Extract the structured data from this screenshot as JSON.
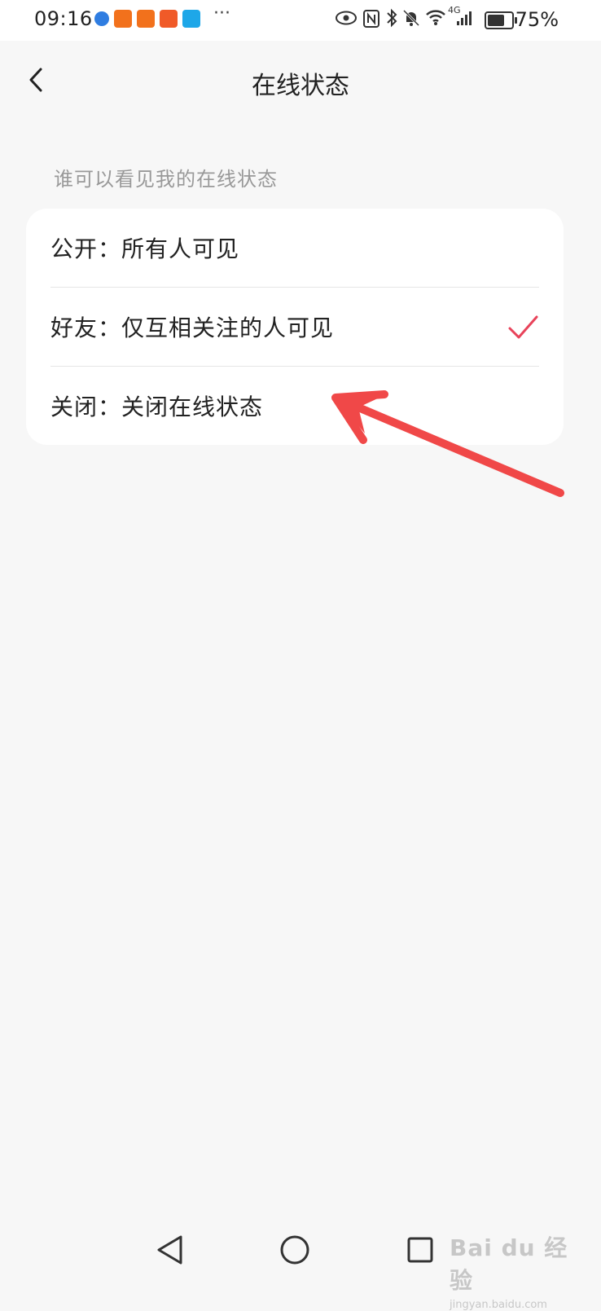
{
  "status_bar": {
    "time": "09:16",
    "battery": "75%",
    "more": "···",
    "network": "4G",
    "icons": [
      "eye-icon",
      "nfc-icon",
      "bluetooth-icon",
      "bell-off-icon",
      "wifi-icon",
      "signal-icon",
      "battery-icon"
    ],
    "app_icons": [
      {
        "name": "browser-app-icon",
        "color": "#2f7de1"
      },
      {
        "name": "app-icon-1",
        "color": "#f2711c"
      },
      {
        "name": "app-icon-2",
        "color": "#f2711c"
      },
      {
        "name": "app-icon-3",
        "color": "#f05a28"
      },
      {
        "name": "app-icon-4",
        "color": "#1ea7e8"
      }
    ]
  },
  "header": {
    "title": "在线状态"
  },
  "section": {
    "label": "谁可以看见我的在线状态"
  },
  "options": [
    {
      "label": "公开：所有人可见",
      "selected": false
    },
    {
      "label": "好友：仅互相关注的人可见",
      "selected": true
    },
    {
      "label": "关闭：关闭在线状态",
      "selected": false
    }
  ],
  "colors": {
    "accent": "#e8435a",
    "background": "#f7f7f7",
    "card": "#ffffff",
    "secondary_text": "#999999",
    "annotation": "#f04848"
  },
  "watermark": {
    "brand": "Bai du 经验",
    "sub": "jingyan.baidu.com"
  }
}
